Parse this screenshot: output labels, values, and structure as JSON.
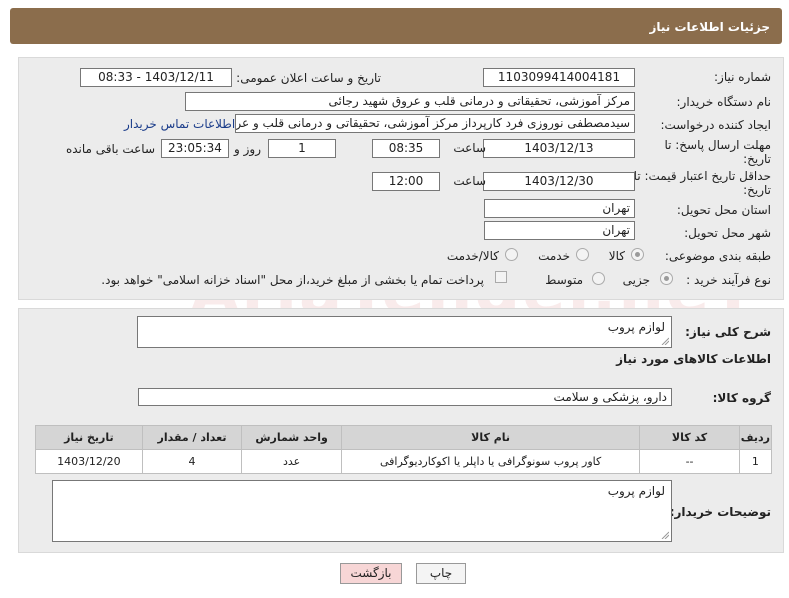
{
  "header": {
    "title": "جزئیات اطلاعات نیاز"
  },
  "form": {
    "need_number_label": "شماره نیاز:",
    "need_number": "1103099414004181",
    "announce_label": "تاریخ و ساعت اعلان عمومی:",
    "announce_value": "1403/12/11 - 08:33",
    "buyer_org_label": "نام دستگاه خریدار:",
    "buyer_org": "مرکز آموزشی، تحقیقاتی و درمانی قلب و عروق شهید رجائی",
    "creator_label": "ایجاد کننده درخواست:",
    "creator": "سیدمصطفی نوروزی فرد کارپرداز مرکز آموزشی، تحقیقاتی و درمانی قلب و عروق",
    "contact_link": "اطلاعات تماس خریدار",
    "reply_deadline_label": "مهلت ارسال پاسخ: تا",
    "date_word": "تاریخ:",
    "reply_date": "1403/12/13",
    "time_label": "ساعت",
    "reply_time": "08:35",
    "days_value": "1",
    "days_label": "روز و",
    "remaining_time": "23:05:34",
    "remaining_label": "ساعت باقی مانده",
    "price_validity_label": "حداقل تاریخ اعتبار قیمت: تا",
    "price_date": "1403/12/30",
    "price_time": "12:00",
    "province_label": "استان محل تحویل:",
    "province": "تهران",
    "city_label": "شهر محل تحویل:",
    "city": "تهران",
    "category_label": "طبقه بندی موضوعی:",
    "category_options": [
      "کالا",
      "خدمت",
      "کالا/خدمت"
    ],
    "process_label": "نوع فرآیند خرید :",
    "process_options": [
      "جزیی",
      "متوسط"
    ],
    "payment_note": "پرداخت تمام یا بخشی از مبلغ خرید،از محل \"اسناد خزانه اسلامی\" خواهد بود."
  },
  "details": {
    "summary_label": "شرح کلی نیاز:",
    "summary": "لوازم پروب",
    "items_heading": "اطلاعات کالاهای مورد نیاز",
    "group_label": "گروه کالا:",
    "group": "دارو، پزشکی و سلامت",
    "columns": [
      "ردیف",
      "کد کالا",
      "نام کالا",
      "واحد شمارش",
      "تعداد / مقدار",
      "تاریخ نیاز"
    ],
    "rows": [
      [
        "1",
        "--",
        "کاور پروب سونوگرافی یا داپلر یا اکوکاردیوگرافی",
        "عدد",
        "4",
        "1403/12/20"
      ]
    ],
    "buyer_notes_label": "توضیحات خریدار:",
    "buyer_notes": "لوازم پروب"
  },
  "buttons": {
    "print": "چاپ",
    "back": "بازگشت"
  },
  "colors": {
    "header_bg": "#8b6d4c",
    "panel_bg": "#ececec",
    "link": "#1a3c8a",
    "back_btn_bg": "#f7d6d6"
  }
}
